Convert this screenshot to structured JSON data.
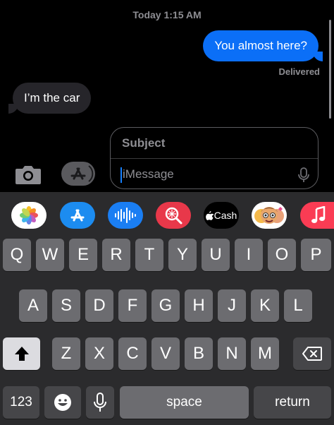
{
  "conversation": {
    "timestamp": "Today 1:15 AM",
    "outgoing": "You almost here?",
    "status": "Delivered",
    "incoming": "I’m the car"
  },
  "compose": {
    "subject_placeholder": "Subject",
    "message_placeholder": "iMessage"
  },
  "apps": [
    {
      "name": "photos-icon"
    },
    {
      "name": "app-store-icon"
    },
    {
      "name": "audio-message-icon"
    },
    {
      "name": "images-search-icon"
    },
    {
      "name": "apple-cash-icon",
      "label": "Cash"
    },
    {
      "name": "memoji-icon"
    },
    {
      "name": "music-icon"
    }
  ],
  "keyboard": {
    "row1": [
      "Q",
      "W",
      "E",
      "R",
      "T",
      "Y",
      "U",
      "I",
      "O",
      "P"
    ],
    "row2": [
      "A",
      "S",
      "D",
      "F",
      "G",
      "H",
      "J",
      "K",
      "L"
    ],
    "row3": [
      "Z",
      "X",
      "C",
      "V",
      "B",
      "N",
      "M"
    ],
    "numbers_label": "123",
    "space_label": "space",
    "return_label": "return"
  },
  "colors": {
    "outgoing_bubble": "#0b6ff7",
    "incoming_bubble": "#26252a",
    "keyboard_bg": "#2b2b2d"
  }
}
